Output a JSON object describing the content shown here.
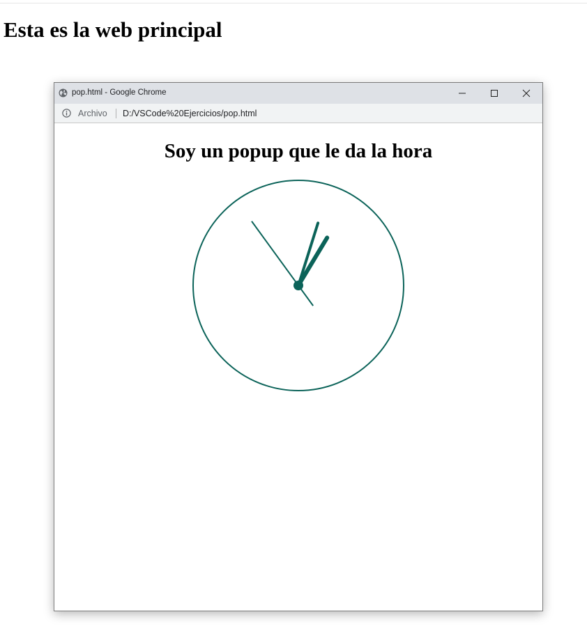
{
  "page": {
    "title": "Esta es la web principal"
  },
  "popup": {
    "window_title": "pop.html - Google Chrome",
    "security_label": "Archivo",
    "url": "D:/VSCode%20Ejercicios/pop.html",
    "heading": "Soy un popup que le da la hora",
    "icons": {
      "globe": "globe-icon",
      "info": "info-icon",
      "minimize": "minimize-icon",
      "maximize": "maximize-icon",
      "close": "close-icon"
    }
  },
  "clock": {
    "color": "#0b6359",
    "time": {
      "hours": 1,
      "minutes": 2,
      "seconds": 54
    }
  }
}
